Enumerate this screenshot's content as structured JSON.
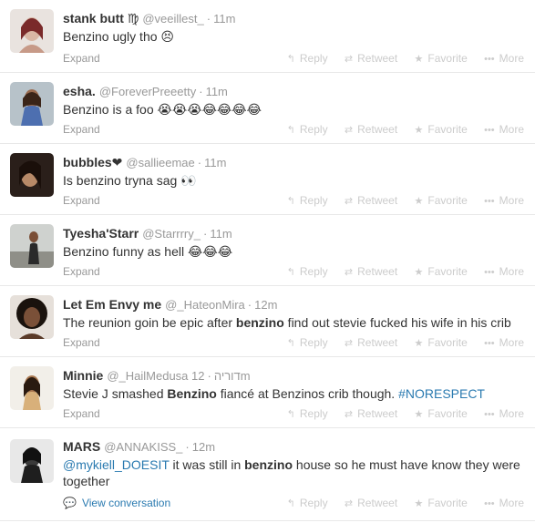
{
  "labels": {
    "expand": "Expand",
    "reply": "Reply",
    "retweet": "Retweet",
    "favorite": "Favorite",
    "more": "More",
    "view_conversation": "View conversation"
  },
  "tweets": [
    {
      "name": "stank butt ♍",
      "handle": "@veeillest_",
      "time": "11m",
      "text": "Benzino ugly tho 😣"
    },
    {
      "name": "esha.",
      "handle": "@ForeverPreeetty",
      "time": "11m",
      "text": "Benzino is a foo 😭😭😭😂😂😂😂"
    },
    {
      "name": "bubbles❤",
      "handle": "@sallieemae",
      "time": "11m",
      "text": "Is benzino tryna sag 👀"
    },
    {
      "name": "Tyesha'Starr",
      "handle": "@Starrrry_",
      "time": "11m",
      "text": "Benzino funny as hell 😂😂😂"
    },
    {
      "name": "Let Em Envy me",
      "handle": "@_HateonMira",
      "time": "12m",
      "text_a": "The reunion goin be epic after ",
      "text_b": "benzino",
      "text_c": " find out stevie fucked his wife in his crib"
    },
    {
      "name": "Minnie",
      "handle": "@_HailMedusa דוריה",
      "time": "12m",
      "text_a": "Stevie J smashed ",
      "text_b": "Benzino",
      "text_c": " fiancé at Benzinos crib though. ",
      "hashtag": "#NORESPECT"
    },
    {
      "name": "MARS",
      "handle": "@ANNAKISS_",
      "time": "12m",
      "mention": "@mykiell_DOESIT",
      "text_a": " it was still in ",
      "text_b": "benzino",
      "text_c": " house so he must have know they were together"
    }
  ]
}
